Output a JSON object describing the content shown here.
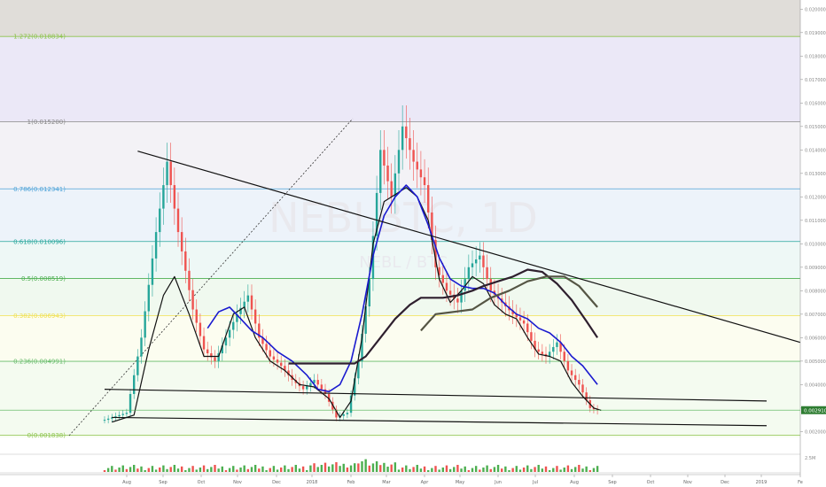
{
  "chart_data": {
    "type": "candlestick",
    "symbol_watermark": "NEBLBTC, 1D",
    "symbol_subtitle_watermark": "NEBL / BTC",
    "price_axis": {
      "min": 0.0015,
      "max": 0.02,
      "ticks": [
        "0.020000",
        "0.019000",
        "0.018000",
        "0.017000",
        "0.016000",
        "0.015000",
        "0.014000",
        "0.013000",
        "0.012000",
        "0.011000",
        "0.010000",
        "0.009000",
        "0.008000",
        "0.007000",
        "0.006000",
        "0.005000",
        "0.004000",
        "0.003000",
        "0.002000"
      ],
      "tick_values": [
        0.02,
        0.019,
        0.018,
        0.017,
        0.016,
        0.015,
        0.014,
        0.013,
        0.012,
        0.011,
        0.01,
        0.009,
        0.008,
        0.007,
        0.006,
        0.005,
        0.004,
        0.003,
        0.002
      ],
      "last_price_label": "0.002910",
      "last_price": 0.00291,
      "volume_tick": "2.5M"
    },
    "time_axis": [
      "Aug",
      "Sep",
      "Oct",
      "Nov",
      "Dec",
      "2018",
      "Feb",
      "Mar",
      "Apr",
      "May",
      "Jun",
      "Jul",
      "Aug",
      "Sep",
      "Oct",
      "Nov",
      "Dec",
      "2019",
      "Fe"
    ],
    "fib_levels": [
      {
        "label": "1.272(0.018834)",
        "price": 0.018834,
        "color": "#8bc34a"
      },
      {
        "label": "1(0.015200)",
        "price": 0.0152,
        "color": "#888888"
      },
      {
        "label": "0.786(0.012341)",
        "price": 0.012341,
        "color": "#4fa3d8"
      },
      {
        "label": "0.618(0.010096)",
        "price": 0.010096,
        "color": "#26a69a"
      },
      {
        "label": "0.5(0.008519)",
        "price": 0.008519,
        "color": "#4caf50"
      },
      {
        "label": "0.382(0.006943)",
        "price": 0.006943,
        "color": "#f0e050"
      },
      {
        "label": "0.236(0.004991)",
        "price": 0.004991,
        "color": "#66bb6a"
      },
      {
        "label": "0(0.001838)",
        "price": 0.001838,
        "color": "#8bc34a"
      }
    ],
    "series": [
      {
        "name": "price_close",
        "points": [
          [
            0,
            0.0025
          ],
          [
            6,
            0.0028
          ],
          [
            10,
            0.006
          ],
          [
            14,
            0.0105
          ],
          [
            17,
            0.0135
          ],
          [
            20,
            0.0105
          ],
          [
            24,
            0.0072
          ],
          [
            27,
            0.0055
          ],
          [
            30,
            0.005
          ],
          [
            33,
            0.006
          ],
          [
            36,
            0.007
          ],
          [
            39,
            0.0078
          ],
          [
            42,
            0.006
          ],
          [
            45,
            0.0052
          ],
          [
            48,
            0.0048
          ],
          [
            51,
            0.0042
          ],
          [
            54,
            0.0038
          ],
          [
            57,
            0.0042
          ],
          [
            60,
            0.0036
          ],
          [
            63,
            0.0026
          ],
          [
            66,
            0.0028
          ],
          [
            69,
            0.005
          ],
          [
            72,
            0.0085
          ],
          [
            75,
            0.014
          ],
          [
            78,
            0.012
          ],
          [
            81,
            0.015
          ],
          [
            84,
            0.0135
          ],
          [
            87,
            0.0125
          ],
          [
            90,
            0.009
          ],
          [
            93,
            0.008
          ],
          [
            96,
            0.0075
          ],
          [
            99,
            0.009
          ],
          [
            102,
            0.0095
          ],
          [
            105,
            0.008
          ],
          [
            108,
            0.0075
          ],
          [
            111,
            0.007
          ],
          [
            114,
            0.0066
          ],
          [
            117,
            0.0055
          ],
          [
            120,
            0.0052
          ],
          [
            123,
            0.0058
          ],
          [
            126,
            0.0046
          ],
          [
            129,
            0.004
          ],
          [
            132,
            0.003
          ],
          [
            134,
            0.0029
          ]
        ]
      },
      {
        "name": "ma_fast",
        "points": [
          [
            2,
            0.0024
          ],
          [
            8,
            0.0027
          ],
          [
            12,
            0.0055
          ],
          [
            16,
            0.0078
          ],
          [
            19,
            0.0086
          ],
          [
            23,
            0.007
          ],
          [
            27,
            0.0052
          ],
          [
            31,
            0.0052
          ],
          [
            35,
            0.007
          ],
          [
            38,
            0.0073
          ],
          [
            41,
            0.006
          ],
          [
            45,
            0.005
          ],
          [
            49,
            0.0046
          ],
          [
            53,
            0.004
          ],
          [
            57,
            0.0039
          ],
          [
            61,
            0.0034
          ],
          [
            64,
            0.0026
          ],
          [
            67,
            0.0033
          ],
          [
            70,
            0.006
          ],
          [
            73,
            0.01
          ],
          [
            76,
            0.0118
          ],
          [
            79,
            0.0121
          ],
          [
            82,
            0.0124
          ],
          [
            85,
            0.012
          ],
          [
            88,
            0.011
          ],
          [
            91,
            0.0085
          ],
          [
            94,
            0.0075
          ],
          [
            97,
            0.008
          ],
          [
            100,
            0.0086
          ],
          [
            103,
            0.0083
          ],
          [
            106,
            0.0074
          ],
          [
            109,
            0.007
          ],
          [
            112,
            0.0068
          ],
          [
            115,
            0.006
          ],
          [
            118,
            0.0053
          ],
          [
            121,
            0.0052
          ],
          [
            124,
            0.005
          ],
          [
            127,
            0.0041
          ],
          [
            130,
            0.0035
          ],
          [
            133,
            0.003
          ],
          [
            135,
            0.0029
          ]
        ]
      },
      {
        "name": "ma_blue",
        "points": [
          [
            28,
            0.0064
          ],
          [
            31,
            0.0071
          ],
          [
            34,
            0.0073
          ],
          [
            37,
            0.0068
          ],
          [
            40,
            0.0063
          ],
          [
            43,
            0.006
          ],
          [
            47,
            0.0054
          ],
          [
            51,
            0.005
          ],
          [
            55,
            0.0044
          ],
          [
            58,
            0.0038
          ],
          [
            61,
            0.0037
          ],
          [
            64,
            0.004
          ],
          [
            67,
            0.005
          ],
          [
            70,
            0.007
          ],
          [
            73,
            0.0095
          ],
          [
            76,
            0.0112
          ],
          [
            79,
            0.012
          ],
          [
            82,
            0.0125
          ],
          [
            85,
            0.012
          ],
          [
            88,
            0.0108
          ],
          [
            91,
            0.0094
          ],
          [
            94,
            0.0085
          ],
          [
            97,
            0.0082
          ],
          [
            100,
            0.0081
          ],
          [
            103,
            0.0081
          ],
          [
            106,
            0.0079
          ],
          [
            109,
            0.0074
          ],
          [
            112,
            0.007
          ],
          [
            115,
            0.0068
          ],
          [
            118,
            0.0064
          ],
          [
            121,
            0.0062
          ],
          [
            124,
            0.0058
          ],
          [
            127,
            0.0052
          ],
          [
            130,
            0.0048
          ],
          [
            134,
            0.004
          ]
        ]
      },
      {
        "name": "ma_dark_a",
        "points": [
          [
            50,
            0.0049
          ],
          [
            55,
            0.0049
          ],
          [
            60,
            0.0049
          ],
          [
            65,
            0.0049
          ],
          [
            68,
            0.0049
          ],
          [
            71,
            0.0052
          ],
          [
            75,
            0.006
          ],
          [
            79,
            0.0068
          ],
          [
            83,
            0.0074
          ],
          [
            86,
            0.0077
          ],
          [
            89,
            0.0077
          ],
          [
            92,
            0.0077
          ],
          [
            96,
            0.0078
          ],
          [
            100,
            0.008
          ],
          [
            103,
            0.0082
          ],
          [
            107,
            0.0084
          ],
          [
            111,
            0.0086
          ],
          [
            115,
            0.0089
          ],
          [
            119,
            0.0088
          ],
          [
            123,
            0.0083
          ],
          [
            127,
            0.0076
          ],
          [
            131,
            0.0067
          ],
          [
            134,
            0.006
          ]
        ]
      },
      {
        "name": "ma_dark_b",
        "points": [
          [
            86,
            0.0063
          ],
          [
            90,
            0.007
          ],
          [
            95,
            0.0071
          ],
          [
            100,
            0.0072
          ],
          [
            105,
            0.0077
          ],
          [
            110,
            0.008
          ],
          [
            115,
            0.0084
          ],
          [
            120,
            0.0086
          ],
          [
            125,
            0.0086
          ],
          [
            129,
            0.0082
          ],
          [
            134,
            0.0073
          ]
        ]
      }
    ],
    "trendlines": [
      {
        "from": [
          9,
          0.01395
        ],
        "to": [
          190,
          0.0058
        ]
      },
      {
        "from": [
          2,
          0.0026
        ],
        "to": [
          180,
          0.00225
        ]
      },
      {
        "from": [
          0,
          0.0038
        ],
        "to": [
          180,
          0.0033
        ]
      }
    ]
  }
}
